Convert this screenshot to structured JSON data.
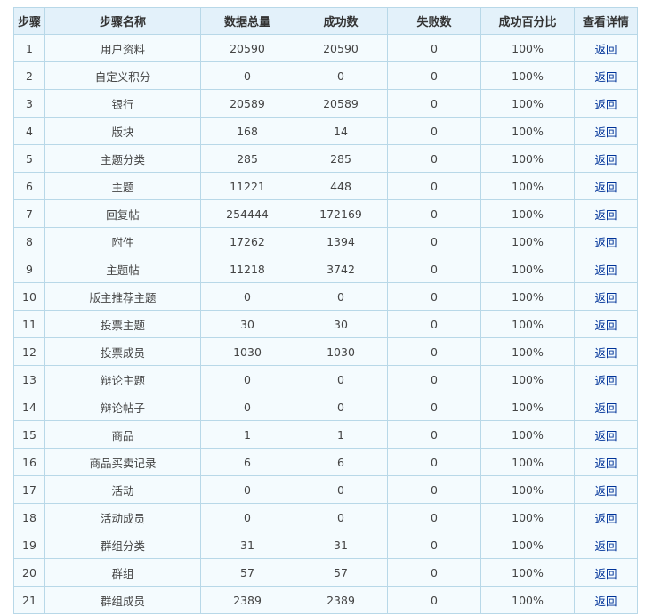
{
  "table": {
    "headers": [
      "步骤",
      "步骤名称",
      "数据总量",
      "成功数",
      "失败数",
      "成功百分比",
      "查看详情"
    ],
    "rows": [
      {
        "step": "1",
        "name": "用户资料",
        "total": "20590",
        "success": "20590",
        "fail": "0",
        "percent": "100%",
        "link": "返回"
      },
      {
        "step": "2",
        "name": "自定义积分",
        "total": "0",
        "success": "0",
        "fail": "0",
        "percent": "100%",
        "link": "返回"
      },
      {
        "step": "3",
        "name": "银行",
        "total": "20589",
        "success": "20589",
        "fail": "0",
        "percent": "100%",
        "link": "返回"
      },
      {
        "step": "4",
        "name": "版块",
        "total": "168",
        "success": "14",
        "fail": "0",
        "percent": "100%",
        "link": "返回"
      },
      {
        "step": "5",
        "name": "主题分类",
        "total": "285",
        "success": "285",
        "fail": "0",
        "percent": "100%",
        "link": "返回"
      },
      {
        "step": "6",
        "name": "主题",
        "total": "11221",
        "success": "448",
        "fail": "0",
        "percent": "100%",
        "link": "返回"
      },
      {
        "step": "7",
        "name": "回复帖",
        "total": "254444",
        "success": "172169",
        "fail": "0",
        "percent": "100%",
        "link": "返回"
      },
      {
        "step": "8",
        "name": "附件",
        "total": "17262",
        "success": "1394",
        "fail": "0",
        "percent": "100%",
        "link": "返回"
      },
      {
        "step": "9",
        "name": "主题帖",
        "total": "11218",
        "success": "3742",
        "fail": "0",
        "percent": "100%",
        "link": "返回"
      },
      {
        "step": "10",
        "name": "版主推荐主题",
        "total": "0",
        "success": "0",
        "fail": "0",
        "percent": "100%",
        "link": "返回"
      },
      {
        "step": "11",
        "name": "投票主题",
        "total": "30",
        "success": "30",
        "fail": "0",
        "percent": "100%",
        "link": "返回"
      },
      {
        "step": "12",
        "name": "投票成员",
        "total": "1030",
        "success": "1030",
        "fail": "0",
        "percent": "100%",
        "link": "返回"
      },
      {
        "step": "13",
        "name": "辩论主题",
        "total": "0",
        "success": "0",
        "fail": "0",
        "percent": "100%",
        "link": "返回"
      },
      {
        "step": "14",
        "name": "辩论帖子",
        "total": "0",
        "success": "0",
        "fail": "0",
        "percent": "100%",
        "link": "返回"
      },
      {
        "step": "15",
        "name": "商品",
        "total": "1",
        "success": "1",
        "fail": "0",
        "percent": "100%",
        "link": "返回"
      },
      {
        "step": "16",
        "name": "商品买卖记录",
        "total": "6",
        "success": "6",
        "fail": "0",
        "percent": "100%",
        "link": "返回"
      },
      {
        "step": "17",
        "name": "活动",
        "total": "0",
        "success": "0",
        "fail": "0",
        "percent": "100%",
        "link": "返回"
      },
      {
        "step": "18",
        "name": "活动成员",
        "total": "0",
        "success": "0",
        "fail": "0",
        "percent": "100%",
        "link": "返回"
      },
      {
        "step": "19",
        "name": "群组分类",
        "total": "31",
        "success": "31",
        "fail": "0",
        "percent": "100%",
        "link": "返回"
      },
      {
        "step": "20",
        "name": "群组",
        "total": "57",
        "success": "57",
        "fail": "0",
        "percent": "100%",
        "link": "返回"
      },
      {
        "step": "21",
        "name": "群组成员",
        "total": "2389",
        "success": "2389",
        "fail": "0",
        "percent": "100%",
        "link": "返回"
      }
    ]
  }
}
